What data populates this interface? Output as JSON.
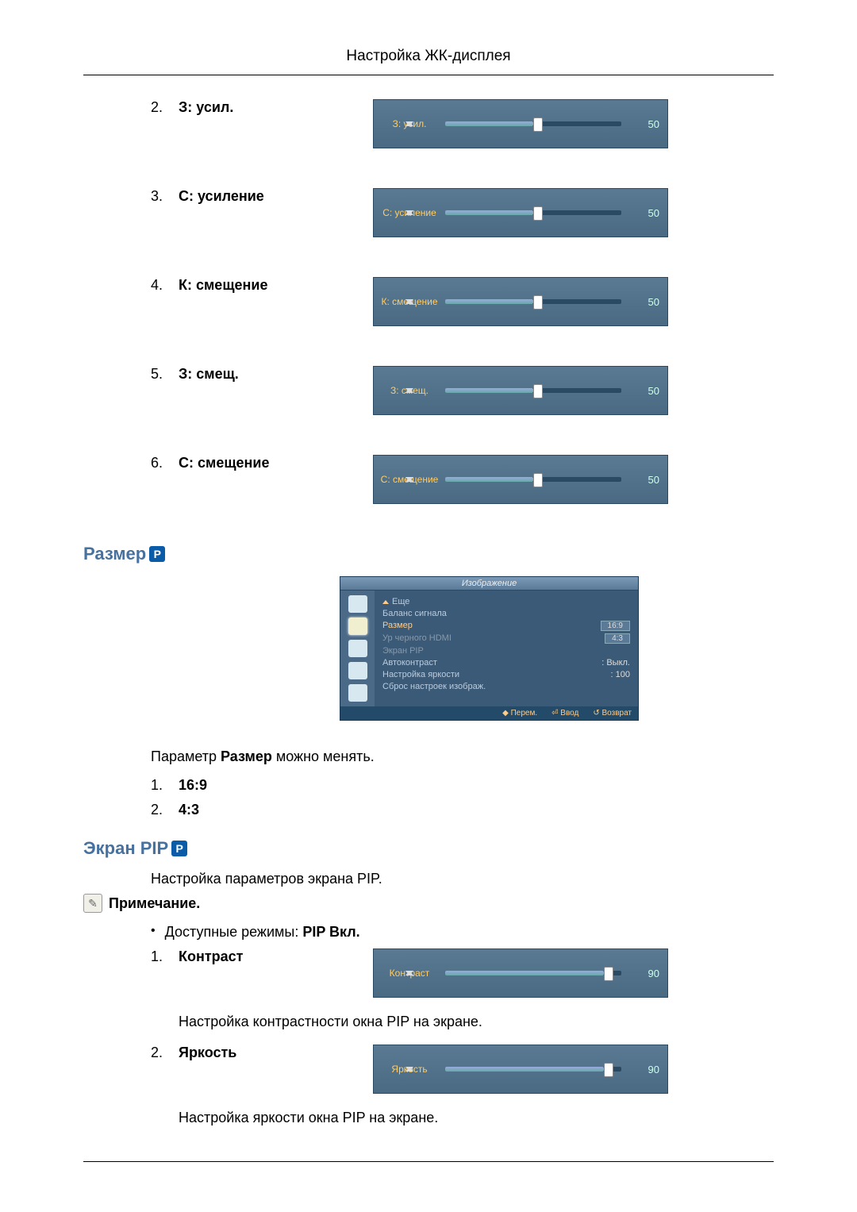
{
  "header": {
    "title": "Настройка ЖК-дисплея"
  },
  "adjustments": {
    "items": [
      {
        "num": "2.",
        "label": "З: усил.",
        "slider_label": "З: усил.",
        "value": "50",
        "pct": 50
      },
      {
        "num": "3.",
        "label": "С: усиление",
        "slider_label": "С:  усиление",
        "value": "50",
        "pct": 50
      },
      {
        "num": "4.",
        "label": "К: смещение",
        "slider_label": "К: смещение",
        "value": "50",
        "pct": 50
      },
      {
        "num": "5.",
        "label": "З: смещ.",
        "slider_label": "З: смещ.",
        "value": "50",
        "pct": 50
      },
      {
        "num": "6.",
        "label": "С: смещение",
        "slider_label": "С: смещение",
        "value": "50",
        "pct": 50
      }
    ]
  },
  "size_section": {
    "title": "Размер",
    "menu": {
      "title": "Изображение",
      "items": {
        "more": "Еще",
        "signal_balance": "Баланс сигнала",
        "size": "Размер",
        "size_val1": "16:9",
        "size_val2": "4:3",
        "hdmi_black": "Ур черного HDMI",
        "pip_screen": "Экран PIP",
        "autocontrast": "Автоконтраст",
        "autocontrast_val": ": Выкл.",
        "brightness_adj": "Настройка яркости",
        "brightness_val": ": 100",
        "reset": "Сброс настроек изображ."
      },
      "footer": {
        "move": "Перем.",
        "enter": "Ввод",
        "return": "Возврат"
      }
    },
    "desc_prefix": "Параметр ",
    "desc_bold": "Размер",
    "desc_suffix": " можно менять.",
    "options": {
      "o1_num": "1.",
      "o1": "16:9",
      "o2_num": "2.",
      "o2": "4:3"
    }
  },
  "pip_section": {
    "title": "Экран PIP",
    "intro": "Настройка параметров экрана PIP.",
    "note_label": "Примечание.",
    "modes_prefix": "Доступные режимы: ",
    "modes_bold": "PIP Вкл.",
    "items": {
      "i1_num": "1.",
      "i1_label": "Контраст",
      "i1_slider_label": "Контраст",
      "i1_value": "90",
      "i1_desc": "Настройка контрастности окна PIP на экране.",
      "i2_num": "2.",
      "i2_label": "Яркость",
      "i2_slider_label": "Яркость",
      "i2_value": "90",
      "i2_desc": "Настройка яркости окна PIP на экране."
    }
  }
}
